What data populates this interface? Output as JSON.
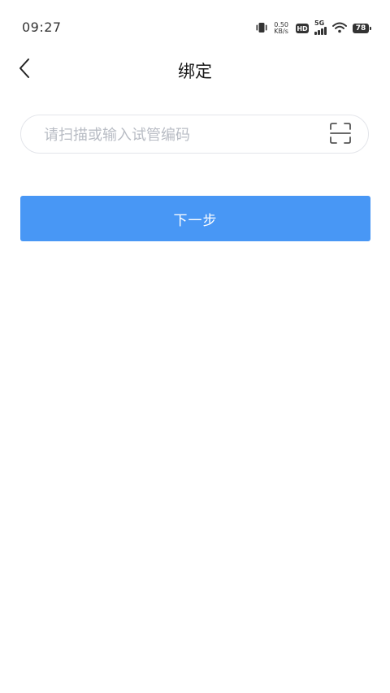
{
  "status_bar": {
    "time": "09:27",
    "net_speed_value": "0.50",
    "net_speed_unit": "KB/s",
    "hd_label": "HD",
    "network_type": "5G",
    "battery_level": "78",
    "icons": [
      "vibrate-icon",
      "hd-icon",
      "signal-icon",
      "wifi-icon",
      "battery-icon"
    ]
  },
  "nav": {
    "title": "绑定",
    "back_icon": "chevron-left-icon"
  },
  "input": {
    "value": "",
    "placeholder": "请扫描或输入试管编码",
    "scan_icon": "scan-frame-icon"
  },
  "actions": {
    "next_label": "下一步"
  },
  "colors": {
    "primary": "#4897f5",
    "placeholder": "#b8bcc4",
    "input_border": "#e3e5ea",
    "background": "#ffffff"
  }
}
